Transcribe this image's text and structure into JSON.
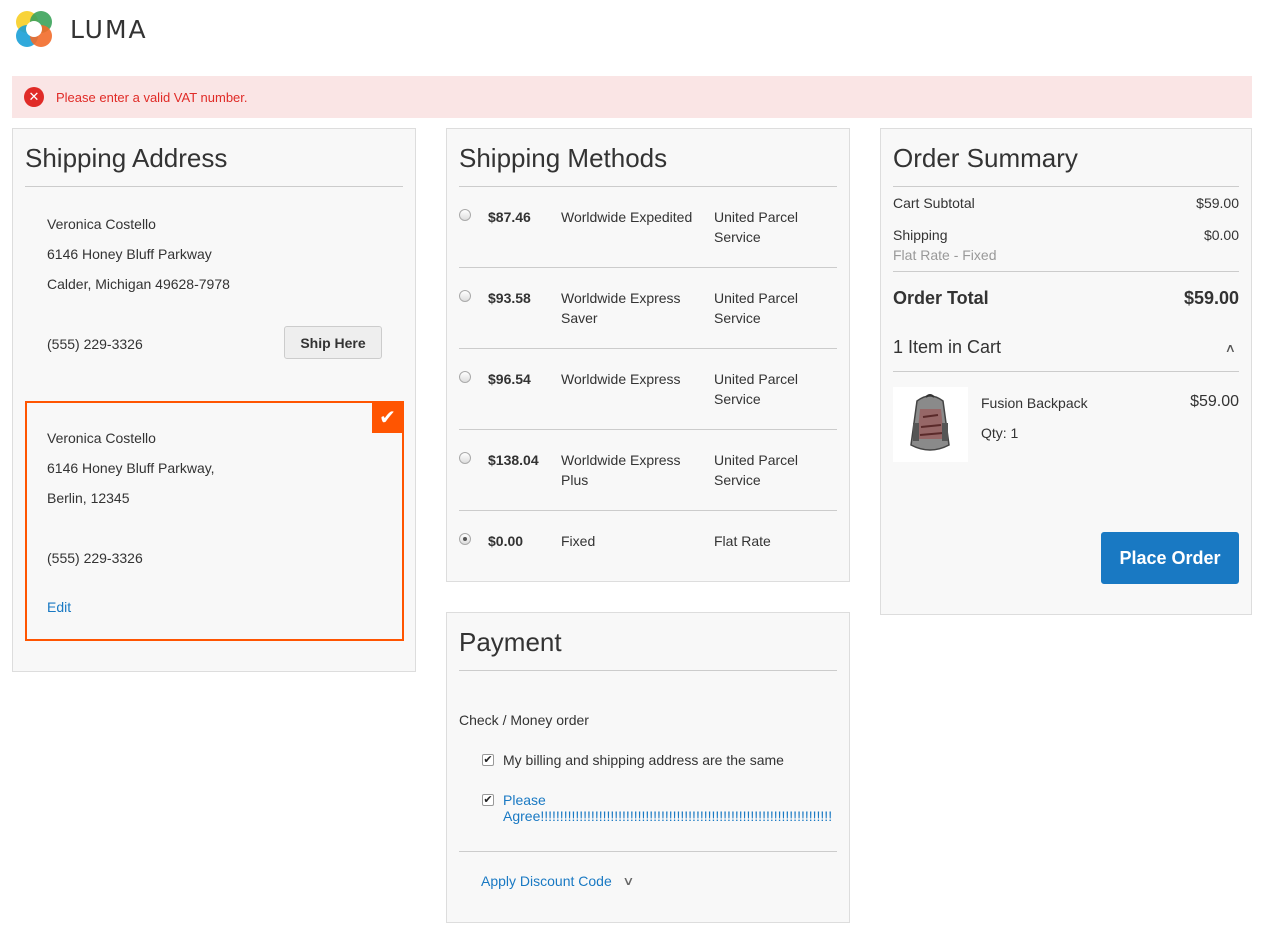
{
  "brand": {
    "name": "LUMA"
  },
  "alert": {
    "message": "Please enter a valid VAT number.",
    "icon": "error-x-icon",
    "color": "#e02b27"
  },
  "shipping_address": {
    "title": "Shipping Address",
    "address1": {
      "name": "Veronica Costello",
      "street": "6146 Honey Bluff Parkway",
      "city_line": "Calder, Michigan 49628-7978",
      "phone": "(555) 229-3326",
      "ship_here_label": "Ship Here"
    },
    "address2": {
      "name": "Veronica Costello",
      "street": "6146 Honey Bluff Parkway,",
      "city_line": "Berlin, 12345",
      "phone": "(555) 229-3326",
      "edit_label": "Edit",
      "selected": true
    }
  },
  "shipping_methods": {
    "title": "Shipping Methods",
    "rows": [
      {
        "price": "$87.46",
        "method": "Worldwide Expedited",
        "carrier": "United Parcel Service",
        "selected": false
      },
      {
        "price": "$93.58",
        "method": "Worldwide Express Saver",
        "carrier": "United Parcel Service",
        "selected": false
      },
      {
        "price": "$96.54",
        "method": "Worldwide Express",
        "carrier": "United Parcel Service",
        "selected": false
      },
      {
        "price": "$138.04",
        "method": "Worldwide Express Plus",
        "carrier": "United Parcel Service",
        "selected": false
      },
      {
        "price": "$0.00",
        "method": "Fixed",
        "carrier": "Flat Rate",
        "selected": true
      }
    ]
  },
  "payment": {
    "title": "Payment",
    "method_label": "Check / Money order",
    "billing_same_label": "My billing and shipping address are the same",
    "billing_same_checked": true,
    "agree_label": "Please Agree!!!!!!!!!!!!!!!!!!!!!!!!!!!!!!!!!!!!!!!!!!!!!!!!!!!!!!!!!!!!!!!!!!!!!!!!!!!",
    "agree_checked": true,
    "discount_label": "Apply Discount Code"
  },
  "order_summary": {
    "title": "Order Summary",
    "cart_subtotal_label": "Cart Subtotal",
    "cart_subtotal_value": "$59.00",
    "shipping_label": "Shipping",
    "shipping_value": "$0.00",
    "shipping_method": "Flat Rate - Fixed",
    "order_total_label": "Order Total",
    "order_total_value": "$59.00",
    "items_in_cart": "1 Item in Cart",
    "item": {
      "name": "Fusion Backpack",
      "price": "$59.00",
      "qty": "Qty: 1"
    },
    "place_order_label": "Place Order"
  },
  "colors": {
    "accent": "#1979c3",
    "selected_border": "#ff5501",
    "error": "#e02b27"
  }
}
